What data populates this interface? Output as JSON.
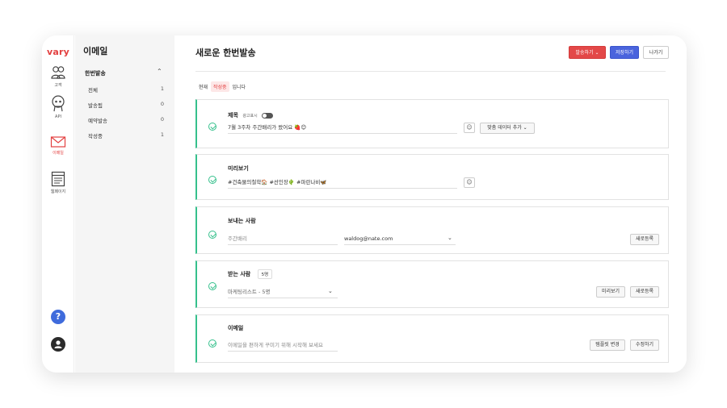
{
  "app": {
    "logo": "vary"
  },
  "rail": {
    "items": [
      {
        "label": "고객",
        "icon": "customers-icon"
      },
      {
        "label": "API",
        "icon": "api-icon"
      },
      {
        "label": "이메일",
        "icon": "mail-icon",
        "active": true
      },
      {
        "label": "웹페이지",
        "icon": "webpage-icon"
      }
    ],
    "help": "?"
  },
  "sidebar": {
    "title": "이메일",
    "group": "한번발송",
    "items": [
      {
        "label": "전체",
        "count": "1"
      },
      {
        "label": "발송됨",
        "count": "0"
      },
      {
        "label": "예약발송",
        "count": "0"
      },
      {
        "label": "작성중",
        "count": "1"
      }
    ]
  },
  "header": {
    "title": "새로운 한번발송",
    "send_label": "발송하기",
    "save_label": "저장하기",
    "exit_label": "나가기"
  },
  "status": {
    "prefix": "현재",
    "tag": "작성중",
    "suffix": "입니다"
  },
  "sections": {
    "subject": {
      "label": "제목",
      "ad_note": "광고표시",
      "value": "7월 3주차 주간배리가 왔어요 🍓😊",
      "emoji": "☺",
      "custom_data_label": "맞춤 데이터 추가"
    },
    "preview": {
      "label": "미리보기",
      "value": "#건축물의철학🏠 #선인장🌵 #파란나비🦋",
      "emoji": "☺"
    },
    "sender": {
      "label": "보내는 사람",
      "name_placeholder": "주간배리",
      "email_value": "waldog@nate.com",
      "register_label": "새로등록"
    },
    "recipient": {
      "label": "받는 사람",
      "count_badge": "5명",
      "list_value": "마케팅리스트 - 5명",
      "preview_label": "미리보기",
      "register_label": "새로등록"
    },
    "email": {
      "label": "이메일",
      "placeholder": "이메일을 편하게 꾸미기 위해 시작해 보세요",
      "template_label": "템플릿 변경",
      "edit_label": "수정하기"
    }
  }
}
